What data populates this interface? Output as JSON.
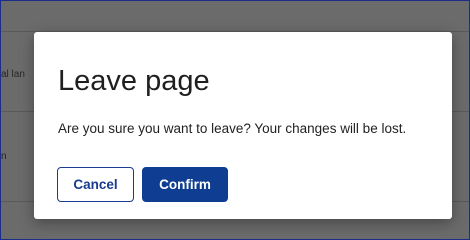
{
  "background": {
    "row_text_1": "al lan",
    "row_text_2": "n"
  },
  "dialog": {
    "title": "Leave page",
    "message": "Are you sure you want to leave? Your changes will be lost.",
    "cancel_label": "Cancel",
    "confirm_label": "Confirm"
  },
  "colors": {
    "primary": "#0f3d91",
    "overlay": "#6b6b6b",
    "frame_border": "#1a2e8a"
  }
}
